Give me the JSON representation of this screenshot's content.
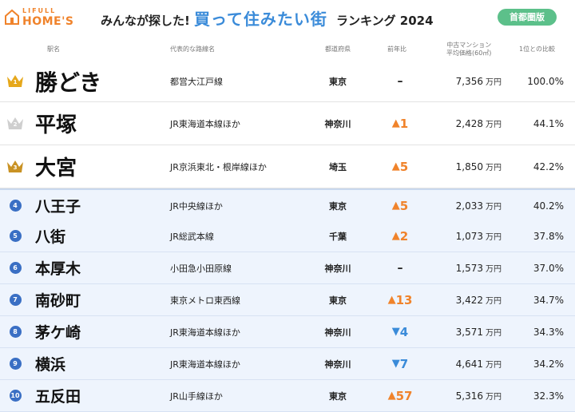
{
  "header": {
    "logo_top": "LIFULL",
    "logo_main": "HOME'S",
    "title_part1": "みんなが探した!",
    "title_part2": "買って住みたい街",
    "title_part3": "ランキング 2024",
    "badge": "首都圏版"
  },
  "columns": {
    "name": "駅名",
    "line": "代表的な路線名",
    "pref": "都道府県",
    "yoy": "前年比",
    "price_line1": "中古マンション",
    "price_line2": "平均価格(60㎡)",
    "ratio": "1位との比較"
  },
  "colors": {
    "gold": "#e6a81c",
    "silver": "#cfcfcf",
    "bronze": "#c99224",
    "rank_circle": "#3a6fc4",
    "up": "#f0832b",
    "down": "#3a8bd9",
    "badge": "#5cc08a"
  },
  "chart_data": {
    "type": "table",
    "unit": "万円",
    "rows": [
      {
        "rank": "1",
        "station": "勝どき",
        "line": "都営大江戸線",
        "pref": "東京",
        "yoy": "–",
        "yoy_dir": "flat",
        "price": "7,356",
        "ratio": "100.0%"
      },
      {
        "rank": "2",
        "station": "平塚",
        "line": "JR東海道本線ほか",
        "pref": "神奈川",
        "yoy": "1",
        "yoy_dir": "up",
        "price": "2,428",
        "ratio": "44.1%"
      },
      {
        "rank": "3",
        "station": "大宮",
        "line": "JR京浜東北・根岸線ほか",
        "pref": "埼玉",
        "yoy": "5",
        "yoy_dir": "up",
        "price": "1,850",
        "ratio": "42.2%"
      },
      {
        "rank": "4",
        "station": "八王子",
        "line": "JR中央線ほか",
        "pref": "東京",
        "yoy": "5",
        "yoy_dir": "up",
        "price": "2,033",
        "ratio": "40.2%"
      },
      {
        "rank": "5",
        "station": "八街",
        "line": "JR総武本線",
        "pref": "千葉",
        "yoy": "2",
        "yoy_dir": "up",
        "price": "1,073",
        "ratio": "37.8%"
      },
      {
        "rank": "6",
        "station": "本厚木",
        "line": "小田急小田原線",
        "pref": "神奈川",
        "yoy": "–",
        "yoy_dir": "flat",
        "price": "1,573",
        "ratio": "37.0%"
      },
      {
        "rank": "7",
        "station": "南砂町",
        "line": "東京メトロ東西線",
        "pref": "東京",
        "yoy": "13",
        "yoy_dir": "up",
        "price": "3,422",
        "ratio": "34.7%"
      },
      {
        "rank": "8",
        "station": "茅ケ崎",
        "line": "JR東海道本線ほか",
        "pref": "神奈川",
        "yoy": "4",
        "yoy_dir": "down",
        "price": "3,571",
        "ratio": "34.3%"
      },
      {
        "rank": "9",
        "station": "横浜",
        "line": "JR東海道本線ほか",
        "pref": "神奈川",
        "yoy": "7",
        "yoy_dir": "down",
        "price": "4,641",
        "ratio": "34.2%"
      },
      {
        "rank": "10",
        "station": "五反田",
        "line": "JR山手線ほか",
        "pref": "東京",
        "yoy": "57",
        "yoy_dir": "up",
        "price": "5,316",
        "ratio": "32.3%"
      }
    ]
  }
}
